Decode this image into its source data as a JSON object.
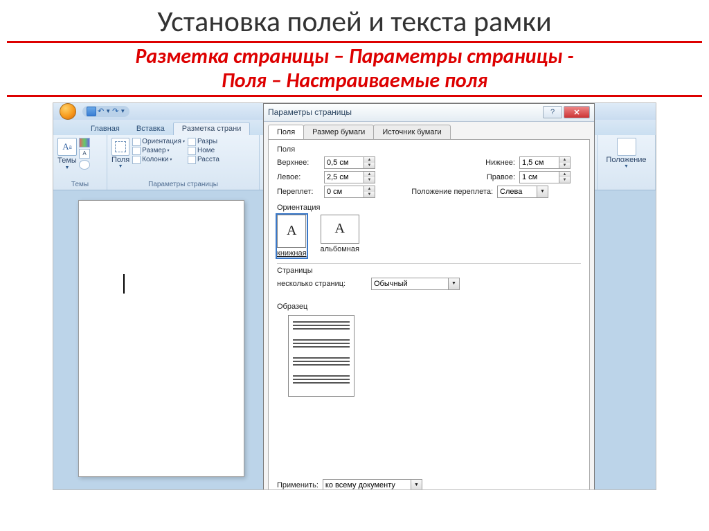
{
  "slide": {
    "title": "Установка полей и текста рамки",
    "subtitle_line1": "Разметка страницы – Параметры страницы -",
    "subtitle_line2": "Поля – Настраиваемые поля"
  },
  "qat": {
    "save": "save",
    "undo": "↶",
    "redo": "↷"
  },
  "ribbon_tabs": [
    "Главная",
    "Вставка",
    "Разметка страни"
  ],
  "ribbon": {
    "themes": {
      "btn": "Темы",
      "group": "Темы"
    },
    "page_setup": {
      "fields": "Поля",
      "orientation": "Ориентация",
      "size": "Размер",
      "columns": "Колонки",
      "breaks": "Разры",
      "line_numbers": "Номе",
      "hyphenation": "Расста",
      "group": "Параметры страницы"
    },
    "position": {
      "btn": "Положение"
    }
  },
  "dialog": {
    "title": "Параметры страницы",
    "help": "?",
    "close": "✕",
    "tabs": [
      "Поля",
      "Размер бумаги",
      "Источник бумаги"
    ],
    "fields_group": "Поля",
    "labels": {
      "top": "Верхнее:",
      "bottom": "Нижнее:",
      "left": "Левое:",
      "right": "Правое:",
      "gutter": "Переплет:",
      "gutter_pos": "Положение переплета:"
    },
    "values": {
      "top": "0,5 см",
      "bottom": "1,5 см",
      "left": "2,5 см",
      "right": "1 см",
      "gutter": "0 см",
      "gutter_pos": "Слева"
    },
    "orientation_group": "Ориентация",
    "orientation": {
      "portrait": "книжная",
      "landscape": "альбомная",
      "letter": "A"
    },
    "pages_group": "Страницы",
    "multiple_pages_label": "несколько страниц:",
    "multiple_pages_value": "Обычный",
    "preview_group": "Образец",
    "apply_label": "Применить:",
    "apply_value": "ко всему документу"
  }
}
